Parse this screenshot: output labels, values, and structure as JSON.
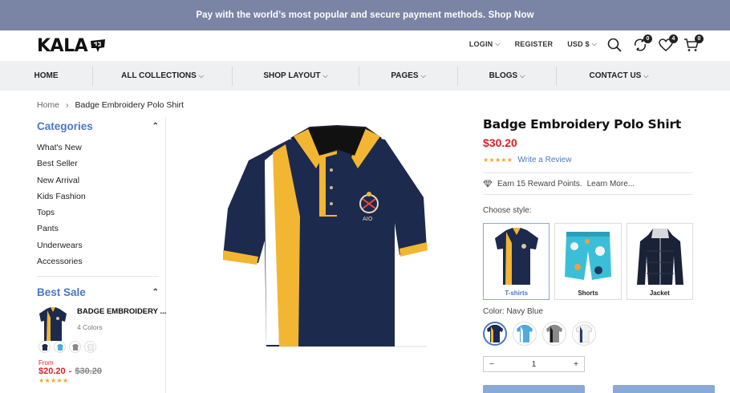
{
  "promo": {
    "text": "Pay with the world’s most popular and secure payment methods. Shop Now"
  },
  "header": {
    "logo": "KALA",
    "links": {
      "login": "LOGIN",
      "register": "REGISTER",
      "currency": "USD $"
    },
    "icons": [
      "search-icon",
      "compare-icon",
      "heart-icon",
      "cart-icon"
    ],
    "compare_count": "0",
    "wishlist_count": "4",
    "cart_count": "0"
  },
  "nav": {
    "items": [
      {
        "label": "HOME",
        "dropdown": false
      },
      {
        "label": "ALL COLLECTIONS",
        "dropdown": true
      },
      {
        "label": "SHOP LAYOUT",
        "dropdown": true
      },
      {
        "label": "PAGES",
        "dropdown": true
      },
      {
        "label": "BLOGS",
        "dropdown": true
      },
      {
        "label": "CONTACT US",
        "dropdown": true
      }
    ]
  },
  "breadcrumb": {
    "home": "Home",
    "separator": "›",
    "current": "Badge Embroidery Polo Shirt"
  },
  "sidebar": {
    "categories_title": "Categories",
    "categories": [
      "What's New",
      "Best Seller",
      "New Arrival",
      "Kids Fashion",
      "Tops",
      "Pants",
      "Underwears",
      "Accessories"
    ],
    "best_sale_title": "Best Sale",
    "best_sale_item": {
      "name": "BADGE EMBROIDERY ...",
      "colors_text": "4 Colors",
      "from": "From",
      "price_new": "$20.20",
      "dash": "-",
      "price_old": "$30.20",
      "rating": 5
    }
  },
  "product": {
    "title": "Badge Embroidery Polo Shirt",
    "price": "$30.20",
    "rating": 5,
    "write_review": "Write a Review",
    "reward": "Earn 15 Reward Points.",
    "learn_more": "Learn More...",
    "choose_style_label": "Choose style:",
    "styles": [
      {
        "label": "T-shirts",
        "selected": true
      },
      {
        "label": "Shorts",
        "selected": false
      },
      {
        "label": "Jacket",
        "selected": false
      }
    ],
    "color_label": "Color: Navy Blue",
    "colors": [
      {
        "name": "Navy Blue",
        "hex": "#1c2a4e",
        "accent": "#f2b632",
        "selected": true
      },
      {
        "name": "Sky Blue",
        "hex": "#4ea9dc",
        "accent": "#ffffff",
        "selected": false
      },
      {
        "name": "Grey",
        "hex": "#8a8a8a",
        "accent": "#1a1a1a",
        "selected": false
      },
      {
        "name": "White",
        "hex": "#f2f2f2",
        "accent": "#2a3b6a",
        "selected": false
      }
    ],
    "quantity": "1",
    "qty_minus": "−",
    "qty_plus": "+"
  },
  "colors": {
    "promo_bg": "#7a84a5",
    "accent": "#4a78c8",
    "price": "#d81f26",
    "nav_bg": "#eef0f1",
    "star": "#f5a623"
  }
}
